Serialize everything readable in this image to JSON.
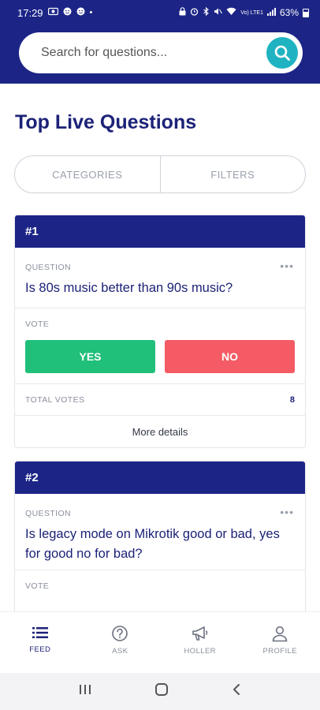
{
  "status_bar": {
    "time": "17:29",
    "battery": "63%",
    "network": "Vo) LTE1",
    "dot": "•"
  },
  "search": {
    "placeholder": "Search for questions..."
  },
  "page": {
    "title": "Top Live Questions"
  },
  "segments": {
    "categories": "CATEGORIES",
    "filters": "FILTERS"
  },
  "questions": [
    {
      "rank": "#1",
      "question_label": "QUESTION",
      "text": "Is 80s music better than 90s music?",
      "vote_label": "VOTE",
      "yes": "YES",
      "no": "NO",
      "total_votes_label": "TOTAL VOTES",
      "total_votes": "8",
      "more_details": "More details",
      "menu": "•••"
    },
    {
      "rank": "#2",
      "question_label": "QUESTION",
      "text": "Is legacy mode on Mikrotik good or bad, yes for good no for bad?",
      "vote_label": "VOTE",
      "menu": "•••"
    }
  ],
  "bottom_nav": [
    {
      "label": "FEED",
      "icon": "list-icon",
      "active": true
    },
    {
      "label": "ASK",
      "icon": "question-circle-icon",
      "active": false
    },
    {
      "label": "HOLLER",
      "icon": "megaphone-icon",
      "active": false
    },
    {
      "label": "PROFILE",
      "icon": "person-icon",
      "active": false
    }
  ],
  "colors": {
    "primary": "#1c2586",
    "accent": "#1fb3c2",
    "yes": "#20bf7a",
    "no": "#f45b64"
  }
}
